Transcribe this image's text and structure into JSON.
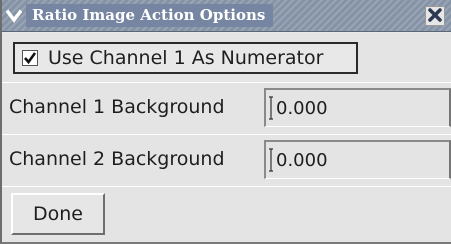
{
  "window": {
    "title": "Ratio Image Action Options",
    "menu_icon": "chevron-down-icon",
    "close_icon": "close-icon"
  },
  "options": {
    "use_channel1_numerator": {
      "label": "Use Channel 1 As Numerator",
      "checked": true
    },
    "channel1_background": {
      "label": "Channel 1 Background",
      "value": "0.000"
    },
    "channel2_background": {
      "label": "Channel 2 Background",
      "value": "0.000"
    }
  },
  "buttons": {
    "done_label": "Done"
  },
  "colors": {
    "titlebar": "#8593a6",
    "title_text": "#ffffff",
    "panel_background": "#e4e4e4"
  }
}
